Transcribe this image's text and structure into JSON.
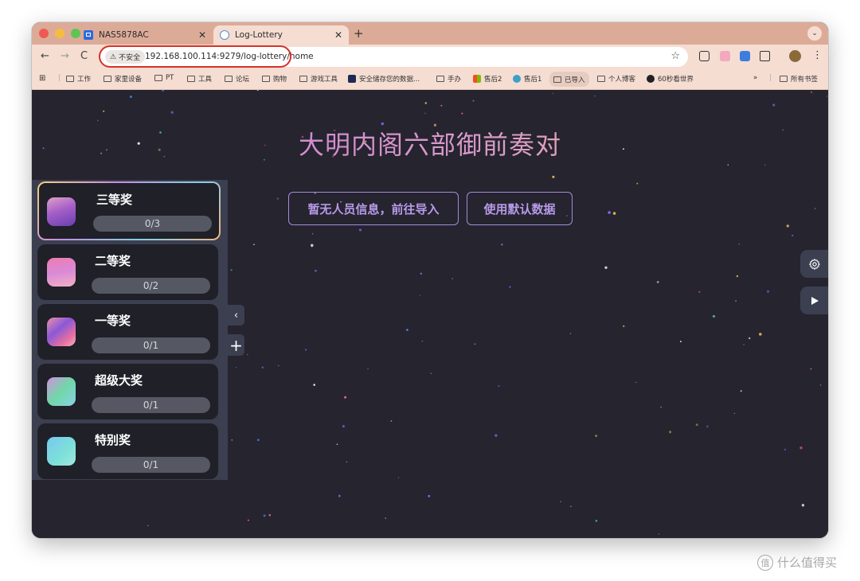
{
  "browser": {
    "tabs": [
      {
        "title": "NAS5878AC",
        "icon": "nas-favicon"
      },
      {
        "title": "Log-Lottery",
        "icon": "log-lottery-favicon",
        "active": true
      }
    ],
    "security_label": "不安全",
    "url": "192.168.100.114:9279/log-lottery/home",
    "bookmarks": [
      {
        "label": "工作",
        "icon": "folder-icon"
      },
      {
        "label": "家里设备",
        "icon": "folder-icon"
      },
      {
        "label": "PT",
        "icon": "folder-icon"
      },
      {
        "label": "工具",
        "icon": "folder-icon"
      },
      {
        "label": "论坛",
        "icon": "folder-icon"
      },
      {
        "label": "购物",
        "icon": "folder-icon"
      },
      {
        "label": "游戏工具",
        "icon": "folder-icon"
      },
      {
        "label": "安全储存您的数据...",
        "icon": "site-icon"
      },
      {
        "label": "手办",
        "icon": "folder-icon"
      },
      {
        "label": "售后2",
        "icon": "site-icon"
      },
      {
        "label": "售后1",
        "icon": "site-icon"
      },
      {
        "label": "已导入",
        "icon": "folder-icon"
      },
      {
        "label": "个人博客",
        "icon": "folder-icon"
      },
      {
        "label": "60秒看世界",
        "icon": "site-icon"
      }
    ],
    "bookmarks_overflow": "»",
    "all_bookmarks_label": "所有书签"
  },
  "app": {
    "title": "大明内阁六部御前奏对",
    "import_button": "暂无人员信息，前往导入",
    "default_data_button": "使用默认数据",
    "prizes": [
      {
        "name": "三等奖",
        "progress": "0/3",
        "active": true
      },
      {
        "name": "二等奖",
        "progress": "0/2"
      },
      {
        "name": "一等奖",
        "progress": "0/1"
      },
      {
        "name": "超级大奖",
        "progress": "0/1"
      },
      {
        "name": "特别奖",
        "progress": "0/1"
      }
    ],
    "collapse_icon": "‹",
    "add_icon": "+",
    "settings_icon": "gear-icon",
    "play_icon": "play-icon"
  },
  "watermark": {
    "text": "什么值得买",
    "icon_char": "值"
  }
}
